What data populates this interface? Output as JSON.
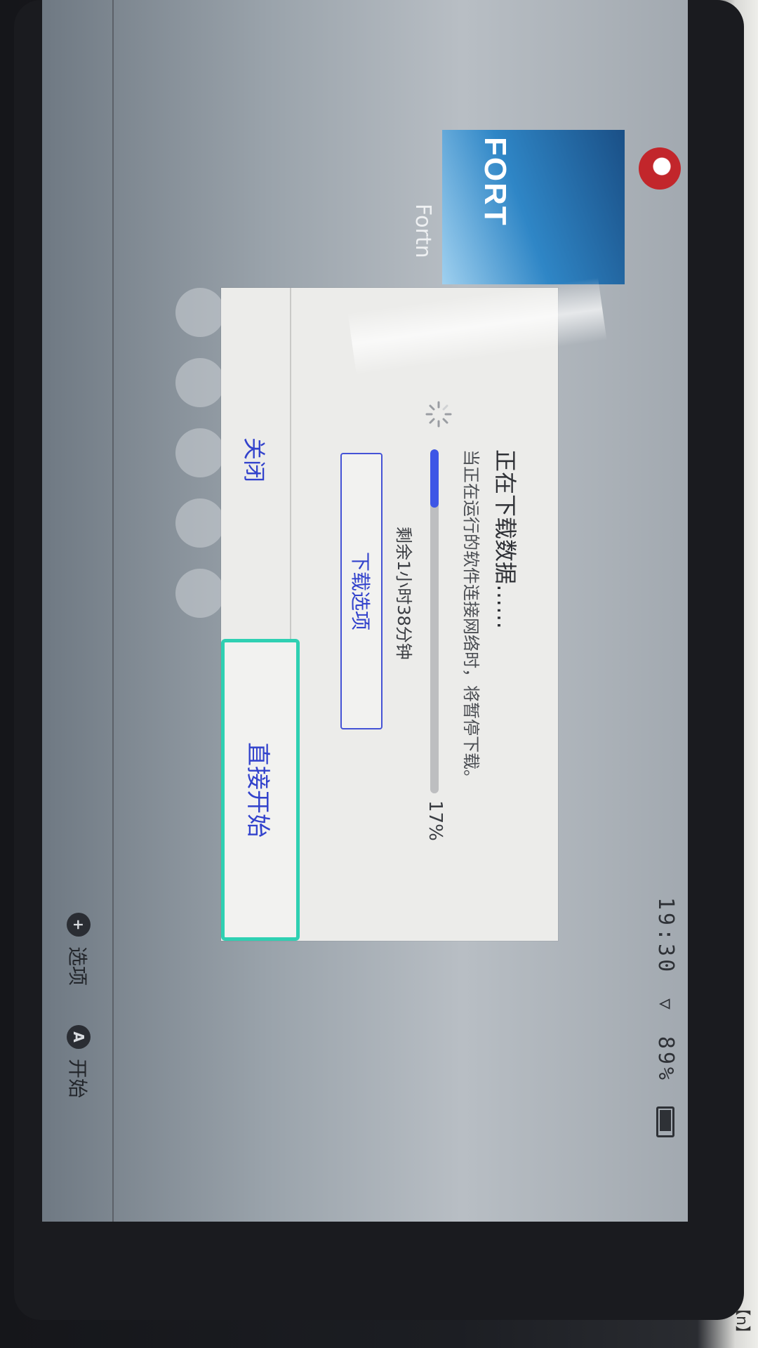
{
  "status_bar": {
    "time": "19:30",
    "battery": "89%"
  },
  "game": {
    "tile_title": "FORT",
    "name": "Fortn"
  },
  "dialog": {
    "title": "正在下载数据……",
    "description": "当正在运行的软件连接网络时，将暂停下载。",
    "progress_percent": 17,
    "progress_label": "17%",
    "remaining": "剩余1小时38分钟",
    "options_button": "下载选项",
    "close_button": "关闭",
    "start_button": "直接开始"
  },
  "bottom_hints": [
    {
      "key": "+",
      "label": "选项"
    },
    {
      "key": "A",
      "label": "开始"
    }
  ],
  "paper_edge": "【n】"
}
